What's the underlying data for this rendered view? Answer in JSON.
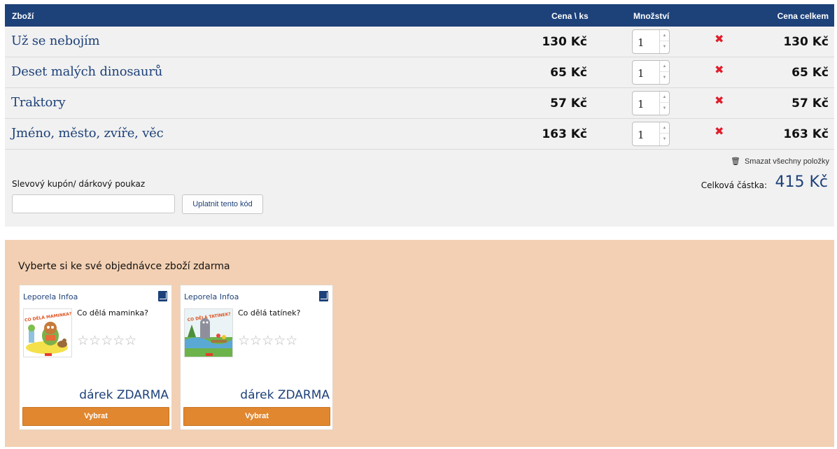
{
  "cart": {
    "headers": {
      "goods": "Zboží",
      "unit_price": "Cena \\ ks",
      "quantity": "Množství",
      "total_price": "Cena celkem"
    },
    "items": [
      {
        "name": "Už se nebojím",
        "unit_price": "130 Kč",
        "quantity": "1",
        "total": "130 Kč"
      },
      {
        "name": "Deset malých dinosaurů",
        "unit_price": "65 Kč",
        "quantity": "1",
        "total": "65 Kč"
      },
      {
        "name": "Traktory",
        "unit_price": "57 Kč",
        "quantity": "1",
        "total": "57 Kč"
      },
      {
        "name": "Jméno, město, zvíře, věc",
        "unit_price": "163 Kč",
        "quantity": "1",
        "total": "163 Kč"
      }
    ],
    "clear_all": "Smazat všechny položky",
    "coupon_label": "Slevový kupón/ dárkový poukaz",
    "coupon_value": "",
    "apply_button": "Uplatnit tento kód",
    "sum_label": "Celková částka:",
    "sum_value": "415 Kč"
  },
  "gifts": {
    "title": "Vyberte si ke své objednávce zboží zdarma",
    "cards": [
      {
        "publisher": "Leporela Infoa",
        "title": "Co dělá maminka?",
        "cover_text": "CO DĚLÁ MAMINKA?",
        "stars": "☆☆☆☆☆",
        "gift_label": "dárek ZDARMA",
        "button": "Vybrat"
      },
      {
        "publisher": "Leporela Infoa",
        "title": "Co dělá tatínek?",
        "cover_text": "CO DĚLÁ TATÍNEK?",
        "stars": "☆☆☆☆☆",
        "gift_label": "dárek ZDARMA",
        "button": "Vybrat"
      }
    ]
  },
  "colors": {
    "header_blue": "#1d4179",
    "delete_red": "#e01d2b",
    "gift_bg": "#f3d0b3",
    "button_orange": "#e08730"
  },
  "icons": [
    "delete-icon",
    "trash-icon",
    "book-icon",
    "star-icon",
    "spin-up-icon",
    "spin-down-icon"
  ]
}
